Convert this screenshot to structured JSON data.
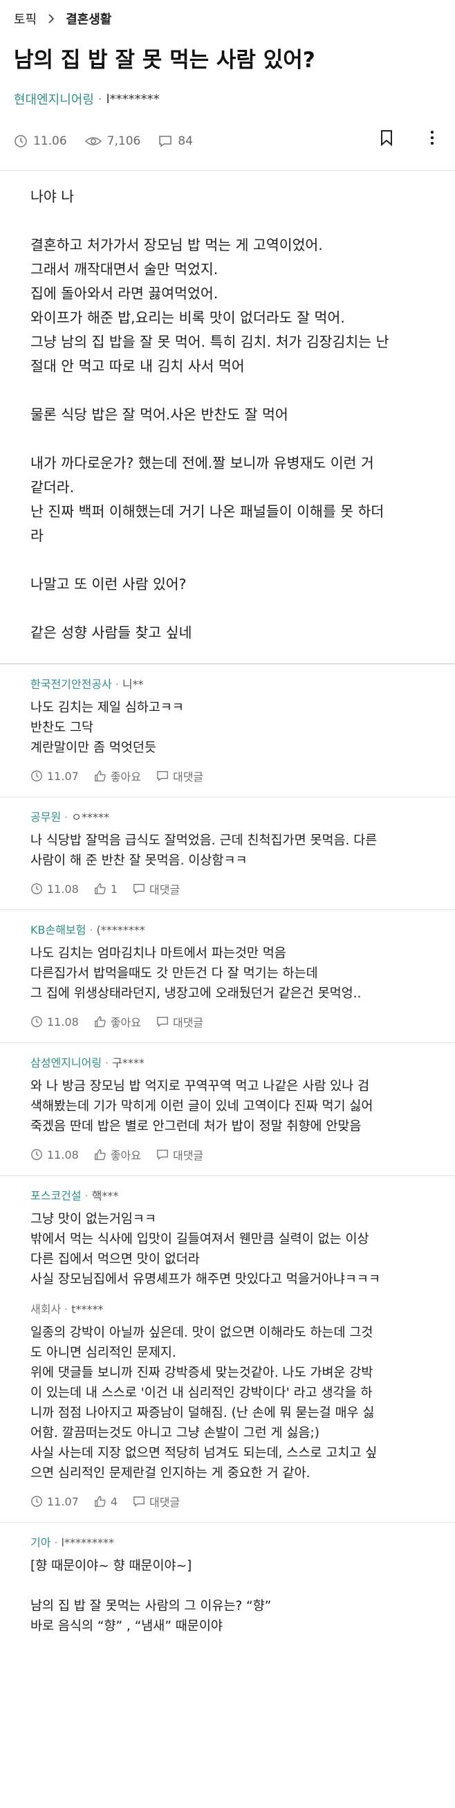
{
  "breadcrumb": {
    "topic": "토픽",
    "board": "결혼생활"
  },
  "post": {
    "title": "남의 집 밥 잘 못 먹는 사람 있어?",
    "author_company": "현대엔지니어링",
    "author_nick": "l********",
    "date": "11.06",
    "views": "7,106",
    "comments": "84",
    "body": [
      "나야 나",
      "",
      "결혼하고 처가가서 장모님 밥 먹는 게 고역이었어.",
      "그래서 깨작대면서 술만 먹었지.",
      "집에 돌아와서 라면 끓여먹었어.",
      "와이프가 해준 밥,요리는 비록 맛이 없더라도 잘 먹어.",
      "그냥 남의 집 밥을 잘 못 먹어. 특히 김치. 처가 김장김치는 난",
      "절대 안 먹고 따로 내 김치 사서 먹어",
      "",
      "물론 식당 밥은 잘 먹어.사온 반찬도 잘 먹어",
      "",
      "내가 까다로운가? 했는데 전에.짤 보니까 유병재도 이런 거",
      "같더라.",
      "난 진짜 백퍼 이해했는데 거기 나온 패널들이 이해를 못 하더",
      "라",
      "",
      "나말고 또 이런 사람 있어?",
      "",
      "같은 성향 사람들 찾고 싶네"
    ]
  },
  "labels": {
    "like": "좋아요",
    "reply": "대댓글"
  },
  "comments": [
    {
      "company": "한국전기안전공사",
      "nick": "니**",
      "body": [
        "나도 김치는 제일 심하고ㅋㅋ",
        "반찬도 그닥",
        "계란말이만 좀 먹엇던듯"
      ],
      "date": "11.07",
      "likes": "좋아요"
    },
    {
      "company": "공무원",
      "nick": "ㅇ*****",
      "body": [
        "나 식당밥 잘먹음 급식도 잘먹었음. 근데 친척집가면 못먹음. 다른",
        "사람이 해 준 반찬 잘 못먹음. 이상함ㅋㅋ"
      ],
      "date": "11.08",
      "likes": "1"
    },
    {
      "company": "KB손해보험",
      "nick": "(********",
      "body": [
        "나도 김치는 엄마김치나 마트에서 파는것만 먹음",
        "다른집가서 밥먹을때도 갓 만든건 다 잘 먹기는 하는데",
        "그 집에 위생상태라던지, 냉장고에 오래뒀던거 같은건 못먹엉.."
      ],
      "date": "11.08",
      "likes": "좋아요"
    },
    {
      "company": "삼성엔지니어링",
      "nick": "구****",
      "body": [
        "와 나 방금 장모님 밥 억지로 꾸역꾸역 먹고 나같은 사람 있나 검",
        "색해봤는데 기가 막히게 이런 글이 있네 고역이다 진짜 먹기 싫어",
        "죽겠음 딴데 밥은 별로 안그런데 처가 밥이 정말 취향에 안맞음"
      ],
      "date": "11.08",
      "likes": "좋아요"
    },
    {
      "company": "포스코건설",
      "nick": "핵***",
      "body": [
        "그냥 맛이 없는거임ㅋㅋ",
        "밖에서 먹는 식사에 입맛이 길들여져서 웬만큼 실력이 없는 이상",
        "다른 집에서 먹으면 맛이 없더라",
        "사실 장모님집에서 유명셰프가 해주면 맛있다고 먹을거아냐ㅋㅋㅋ"
      ],
      "reply": {
        "company": "새회사",
        "nick": "t*****",
        "body": [
          "일종의 강박이 아닐까 싶은데. 맛이 없으면 이해라도 하는데 그것",
          "도 아니면 심리적인 문제지.",
          "위에 댓글들 보니까 진짜 강박증세 맞는것같아. 나도 가벼운 강박",
          "이 있는데 내 스스로 '이건 내 심리적인 강박이다' 라고 생각을 하",
          "니까 점점 나아지고 짜증남이 덜해짐. (난 손에 뭐 묻는걸 매우 싫",
          "어함. 깔끔떠는것도 아니고 그냥 손발이 그런 게 싫음;)",
          "사실 사는데 지장 없으면 적당히 넘겨도 되는데, 스스로 고치고 싶",
          "으면 심리적인 문제란걸 인지하는 게 중요한 거 같아."
        ],
        "date": "11.07",
        "likes": "4"
      }
    },
    {
      "company": "기아",
      "nick": "l*********",
      "body": [
        "[향 때문이야~ 향 때문이야~]",
        "",
        "남의 집 밥 잘 못먹는 사람의 그 이유는? “향”",
        "바로 음식의 “향” , “냄새” 때문이야"
      ]
    }
  ],
  "colors": {
    "accent": "#2f8f8a",
    "muted": "#6e6e6e"
  }
}
